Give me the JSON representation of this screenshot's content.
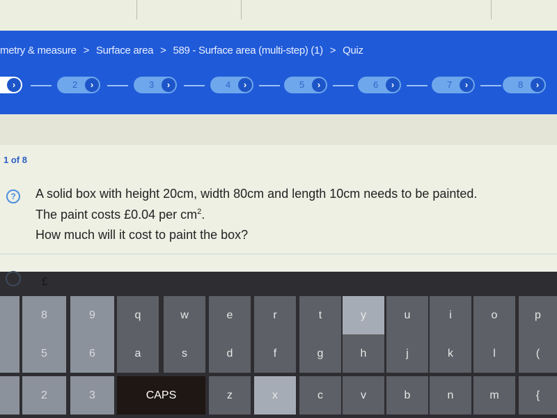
{
  "breadcrumb": [
    "metry & measure",
    ">",
    "Surface area",
    ">",
    "589 - Surface area (multi-step) (1)",
    ">",
    "Quiz"
  ],
  "steps": [
    "",
    "2",
    "3",
    "4",
    "5",
    "6",
    "7",
    "8"
  ],
  "progress": "1 of 8",
  "question": {
    "line1": "A solid box with height 20cm, width 80cm and length 10cm needs to be painted.",
    "line2": "The paint costs £0.04 per cm",
    "line2_sup": "2",
    "line2_end": ".",
    "line3": "How much will it cost to paint the box?"
  },
  "answer_prefix": "£",
  "keyboard": {
    "row1": [
      "8",
      "9",
      "q",
      "w",
      "e",
      "r",
      "t",
      "y",
      "u",
      "i",
      "o",
      "p"
    ],
    "row2": [
      "5",
      "6",
      "a",
      "s",
      "d",
      "f",
      "g",
      "h",
      "j",
      "k",
      "l",
      "("
    ],
    "row3": [
      "2",
      "3",
      "CAPS",
      "z",
      "x",
      "c",
      "v",
      "b",
      "n",
      "m",
      "{"
    ]
  }
}
